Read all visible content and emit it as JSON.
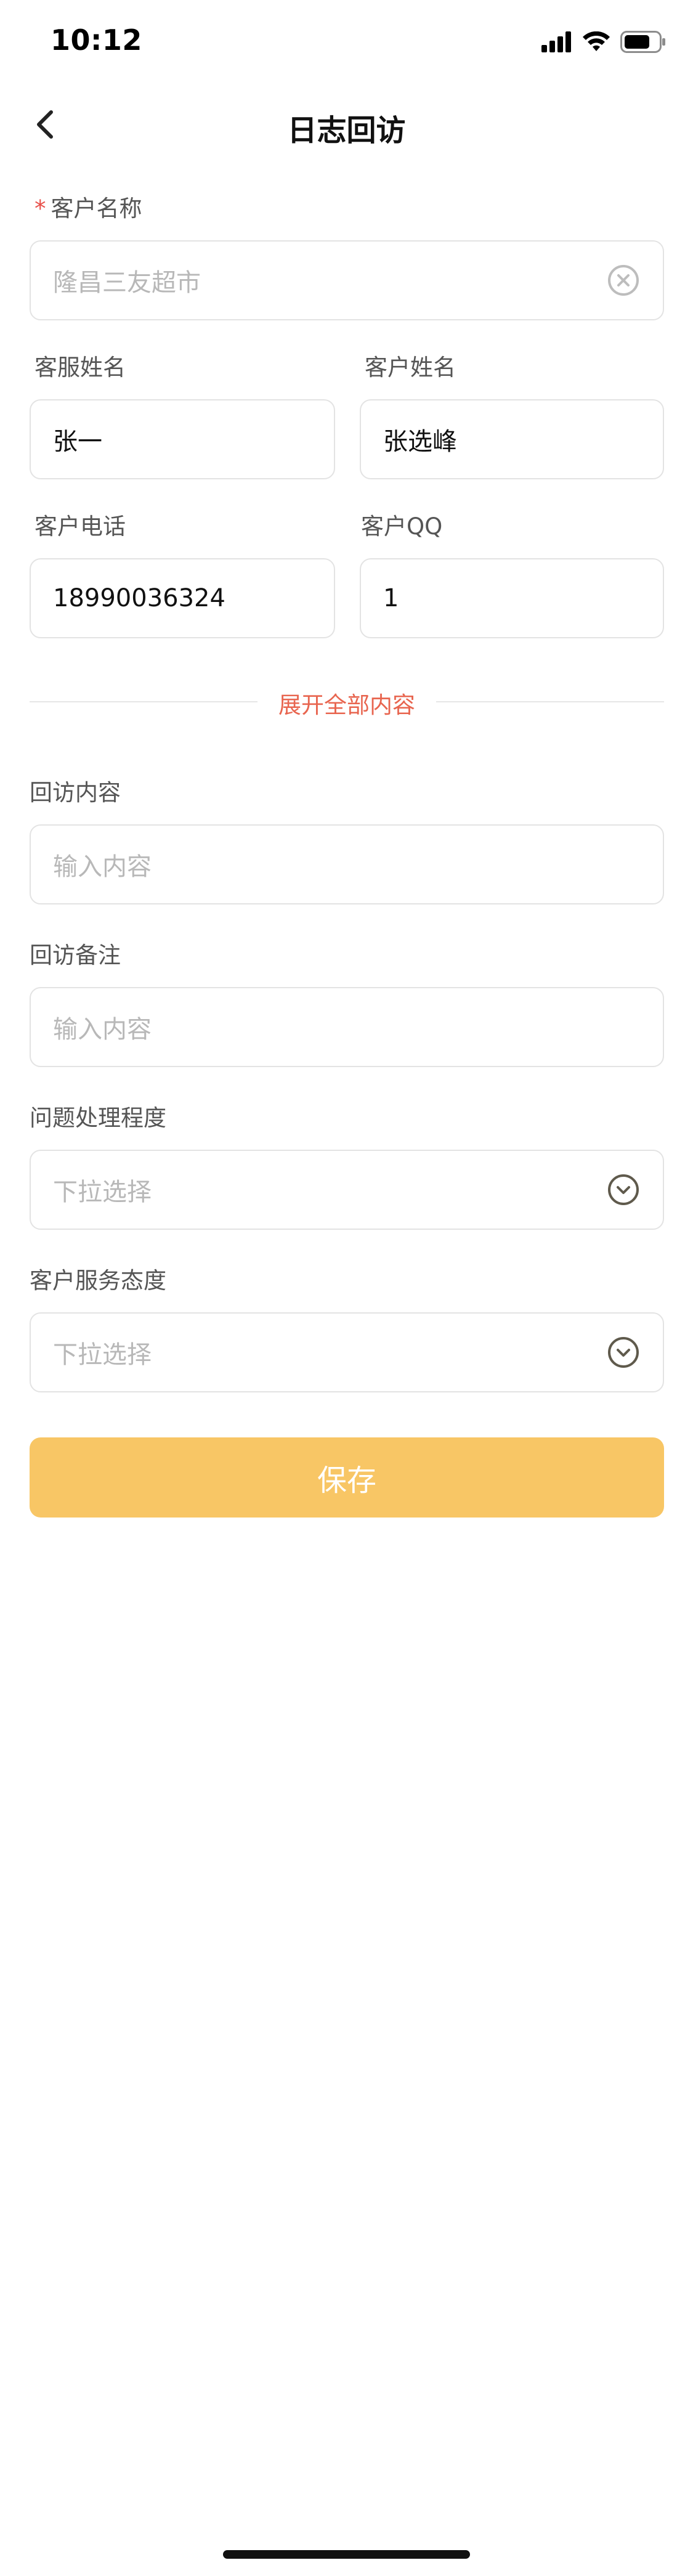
{
  "status_bar": {
    "time": "10:12"
  },
  "nav": {
    "title": "日志回访"
  },
  "form": {
    "customer_name": {
      "label": "客户名称",
      "required_mark": "*",
      "value": "隆昌三友超市"
    },
    "service_name": {
      "label": "客服姓名",
      "value": "张一"
    },
    "customer_person": {
      "label": "客户姓名",
      "value": "张选峰"
    },
    "customer_phone": {
      "label": "客户电话",
      "value": "18990036324"
    },
    "customer_qq": {
      "label": "客户QQ",
      "value": "1"
    },
    "expand_label": "展开全部内容",
    "visit_content": {
      "label": "回访内容",
      "placeholder": "输入内容"
    },
    "visit_note": {
      "label": "回访备注",
      "placeholder": "输入内容"
    },
    "handling_level": {
      "label": "问题处理程度",
      "placeholder": "下拉选择"
    },
    "service_attitude": {
      "label": "客户服务态度",
      "placeholder": "下拉选择"
    },
    "save_label": "保存"
  },
  "colors": {
    "accent": "#f8c665",
    "required": "#e8504a",
    "link": "#e8654f",
    "border": "#e3e3e3",
    "placeholder": "#b8b8b8",
    "icon": "#5f5a4c"
  },
  "icons": [
    "signal-icon",
    "wifi-icon",
    "battery-icon",
    "back-arrow-icon",
    "clear-icon",
    "chevron-down-circle-icon"
  ]
}
